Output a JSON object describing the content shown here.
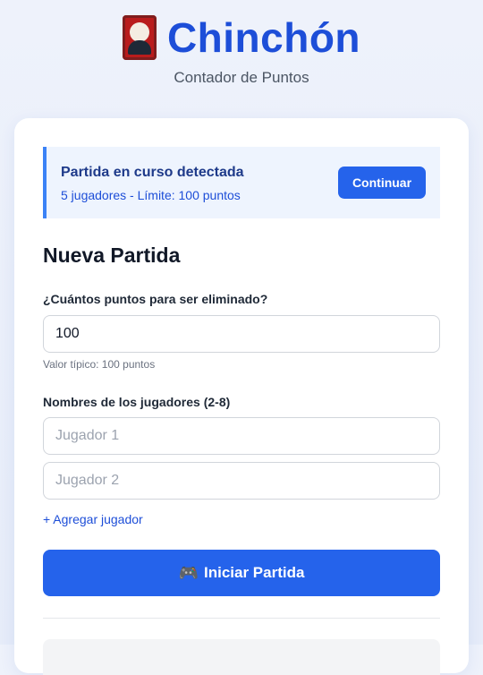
{
  "header": {
    "title": "Chinchón",
    "subtitle": "Contador de Puntos",
    "logo_icon": "playing-card-icon"
  },
  "resume_banner": {
    "title": "Partida en curso detectada",
    "details": "5 jugadores - Límite: 100 puntos",
    "continue_label": "Continuar"
  },
  "new_game": {
    "title": "Nueva Partida",
    "points_label": "¿Cuántos puntos para ser eliminado?",
    "points_value": "100",
    "points_hint": "Valor típico: 100 puntos",
    "players_label": "Nombres de los jugadores (2-8)",
    "players": [
      {
        "placeholder": "Jugador 1",
        "value": ""
      },
      {
        "placeholder": "Jugador 2",
        "value": ""
      }
    ],
    "add_player_label": "+ Agregar jugador",
    "start_label": "Iniciar Partida",
    "start_icon": "gamepad-icon"
  },
  "colors": {
    "accent": "#2563eb",
    "title": "#1d4ed8",
    "banner_bg": "#eef4fe"
  }
}
